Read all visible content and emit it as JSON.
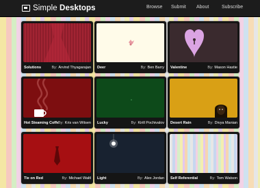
{
  "site": {
    "name_light": "Simple ",
    "name_bold": "Desktops"
  },
  "nav": [
    {
      "label": "Browse"
    },
    {
      "label": "Submit"
    },
    {
      "label": "About"
    },
    {
      "label": "Subscribe"
    }
  ],
  "by_label": "By:",
  "cards": [
    {
      "title": "Solutions",
      "author": "Arvind Thyagarajan"
    },
    {
      "title": "Deer",
      "author": "Ben Barry"
    },
    {
      "title": "Valentine",
      "author": "Mason Hastie"
    },
    {
      "title": "Hot Steaming Coffee",
      "author": "Kris van Witsen"
    },
    {
      "title": "Lucky",
      "author": "Kirill Pochivalov"
    },
    {
      "title": "Desert Rain",
      "author": "Divya Manian"
    },
    {
      "title": "Tie on Red",
      "author": "Michael Waltl"
    },
    {
      "title": "Light",
      "author": "Alex Jordan"
    },
    {
      "title": "Self Referential",
      "author": "Tom Watson"
    }
  ],
  "colors": {
    "topbar": "#1c1c1c",
    "card": "#151515"
  }
}
